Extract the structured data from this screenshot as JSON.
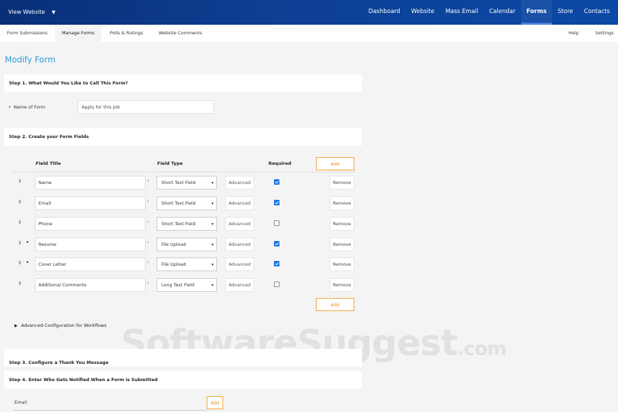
{
  "topbar": {
    "view_website": "View Website",
    "nav": [
      "Dashboard",
      "Website",
      "Mass Email",
      "Calendar",
      "Forms",
      "Store",
      "Contacts"
    ],
    "active": "Forms"
  },
  "subnav": {
    "tabs": [
      "Form Submissions",
      "Manage Forms",
      "Polls & Ratings",
      "Website Comments"
    ],
    "active": "Manage Forms",
    "help": "Help",
    "settings": "Settings"
  },
  "page": {
    "title": "Modify Form",
    "step1": "Step 1. What Would You Like to Call This Form?",
    "name_label": "Name of Form",
    "name_value": "Apply for this Job",
    "step2": "Step 2. Create your Form Fields",
    "columns": {
      "title": "Field Title",
      "type": "Field Type",
      "required": "Required"
    },
    "add_label": "Add",
    "advanced_label": "Advanced",
    "remove_label": "Remove",
    "fields": [
      {
        "title": "Name",
        "type": "Short Text Field",
        "required": true
      },
      {
        "title": "Email",
        "type": "Short Text Field",
        "required": true
      },
      {
        "title": "Phone",
        "type": "Short Text Field",
        "required": false
      },
      {
        "title": "Resume",
        "type": "File Upload",
        "required": true
      },
      {
        "title": "Cover Letter",
        "type": "File Upload",
        "required": true
      },
      {
        "title": "Additional Comments",
        "type": "Long Text Field",
        "required": false
      }
    ],
    "advanced_config": "Advanced Configuration for Workflows",
    "step3": "Step 3. Configure a Thank You Message",
    "step4": "Step 4. Enter Who Gets Notified When a Form is Submitted",
    "email_label": "Email"
  },
  "watermark": {
    "text": "SoftwareSuggest",
    "suffix": ".com"
  },
  "colors": {
    "nav_bg": "#0d3f93",
    "title_blue": "#2f9bd8",
    "add_orange": "#f0a23a",
    "check_blue": "#1a73e8"
  }
}
